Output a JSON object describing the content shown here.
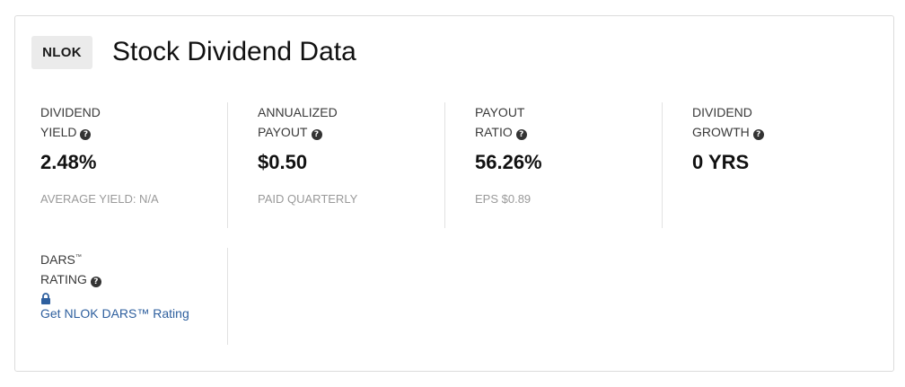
{
  "header": {
    "ticker": "NLOK",
    "title": "Stock Dividend Data"
  },
  "metrics": [
    {
      "label_line1": "DIVIDEND",
      "label_line2": "YIELD",
      "value": "2.48%",
      "sub": "AVERAGE YIELD: N/A"
    },
    {
      "label_line1": "ANNUALIZED",
      "label_line2": "PAYOUT",
      "value": "$0.50",
      "sub": "PAID QUARTERLY"
    },
    {
      "label_line1": "PAYOUT",
      "label_line2": "RATIO",
      "value": "56.26%",
      "sub": "EPS $0.89"
    },
    {
      "label_line1": "DIVIDEND",
      "label_line2": "GROWTH",
      "value": "0 YRS",
      "sub": ""
    }
  ],
  "dars": {
    "label_line1": "DARS",
    "label_tm": "™",
    "label_line2": "RATING",
    "link_text": "Get NLOK DARS™ Rating",
    "link_color": "#2e5f9e"
  },
  "icons": {
    "help": "question-circle-icon",
    "lock": "lock-icon"
  }
}
